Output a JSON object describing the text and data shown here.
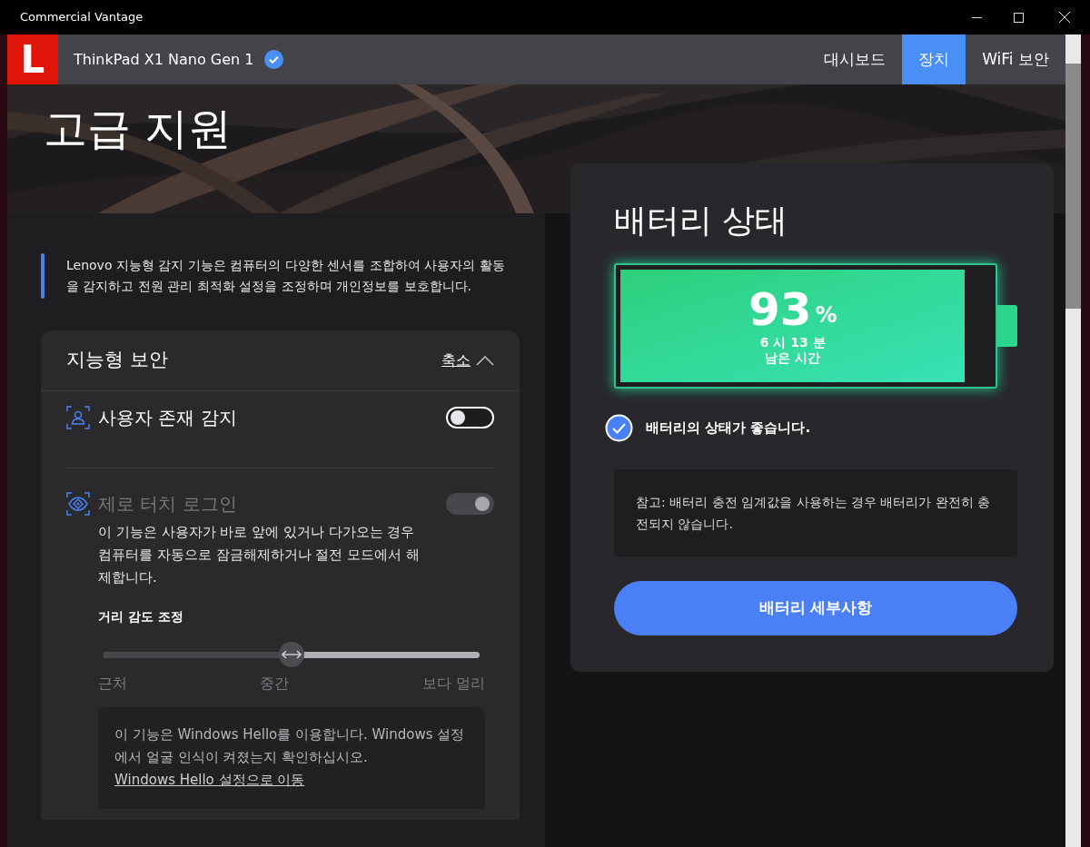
{
  "window": {
    "title": "Commercial Vantage"
  },
  "header": {
    "device": "ThinkPad X1 Nano Gen 1",
    "logo": "L",
    "verified": true
  },
  "tabs": [
    {
      "label": "대시보드",
      "selected": false
    },
    {
      "label": "장치",
      "selected": true
    },
    {
      "label": "WiFi 보안",
      "selected": false
    }
  ],
  "page_title": "고급 지원",
  "intro": "Lenovo 지능형 감지 기능은 컴퓨터의 다양한 센서를 조합하여 사용자의 활동을 감지하고 전원 관리 최적화 설정을 조정하며 개인정보를 보호합니다.",
  "security_card": {
    "title": "지능형 보안",
    "collapse_link": "축소",
    "expanded": true,
    "features": [
      {
        "kind": "presence",
        "label": "사용자 존재 감지",
        "on": false,
        "disabled": false
      },
      {
        "kind": "zero_touch",
        "label": "제로 터치 로그인",
        "on": true,
        "disabled": true,
        "description": "이 기능은 사용자가 바로 앞에 있거나 다가오는 경우 컴퓨터를 자동으로 잠금해제하거나 절전 모드에서 해제합니다."
      }
    ],
    "distance": {
      "title": "거리 감도 조정",
      "level": 0.5,
      "labels": [
        "근처",
        "중간",
        "보다 멀리"
      ]
    },
    "hello_note": {
      "text": "이 기능은 Windows Hello를 이용합니다. Windows 설정에서 얼굴 인식이 켜졌는지 확인하십시오.",
      "link": "Windows Hello 설정으로 이동"
    }
  },
  "battery_card": {
    "title": "배터리 상태",
    "level": 0.93,
    "percent": "93",
    "percent_unit": "%",
    "time_left": "6 시 13 분",
    "time_left_label": "남은 시간",
    "health_ok": true,
    "health_text": "배터리의 상태가 좋습니다.",
    "note": "참고: 배터리 충전 임계값을 사용하는 경우 배터리가 완전히 충전되지 않습니다.",
    "button": "배터리 세부사항"
  }
}
